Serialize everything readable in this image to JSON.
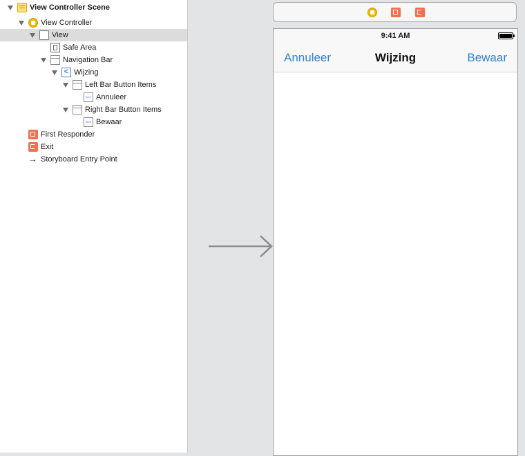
{
  "outline": {
    "items": [
      {
        "label": "View Controller Scene",
        "icon": "scene-icon"
      },
      {
        "label": "View Controller",
        "icon": "view-controller-icon"
      },
      {
        "label": "View",
        "icon": "view-icon"
      },
      {
        "label": "Safe Area",
        "icon": "safe-area-icon"
      },
      {
        "label": "Navigation Bar",
        "icon": "navigation-bar-icon"
      },
      {
        "label": "Wijzing",
        "icon": "navigation-item-icon"
      },
      {
        "label": "Left Bar Button Items",
        "icon": "bar-button-items-icon"
      },
      {
        "label": "Annuleer",
        "icon": "bar-button-item-icon"
      },
      {
        "label": "Right Bar Button Items",
        "icon": "bar-button-items-icon"
      },
      {
        "label": "Bewaar",
        "icon": "bar-button-item-icon"
      },
      {
        "label": "First Responder",
        "icon": "first-responder-icon"
      },
      {
        "label": "Exit",
        "icon": "exit-icon"
      },
      {
        "label": "Storyboard Entry Point",
        "icon": "entry-point-arrow-icon"
      }
    ],
    "item_icon_text": "Item",
    "navigation_item_glyph": "<",
    "entry_arrow_glyph": "→"
  },
  "scene_dock": {
    "icons": [
      "view-controller-icon",
      "first-responder-icon",
      "exit-icon"
    ]
  },
  "device": {
    "status_time": "9:41 AM",
    "nav_left": "Annuleer",
    "nav_title": "Wijzing",
    "nav_right": "Bewaar",
    "tint_color": "#2f82d8"
  }
}
